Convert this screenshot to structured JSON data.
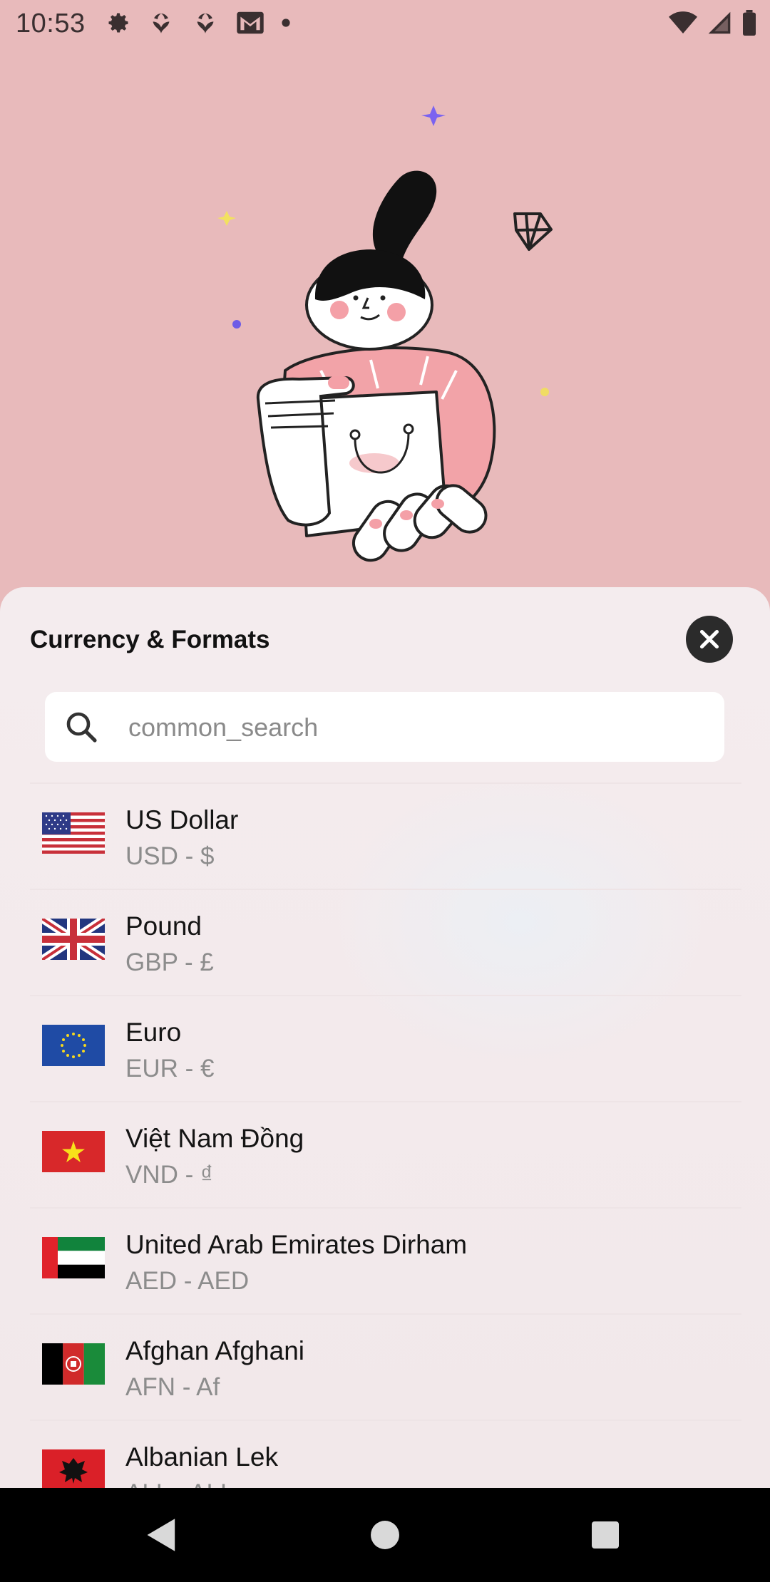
{
  "status_bar": {
    "time": "10:53",
    "left_icons": [
      "settings-icon",
      "app-icon",
      "app-icon",
      "gmail-icon",
      "dot-icon"
    ],
    "right_icons": [
      "wifi-icon",
      "signal-icon",
      "battery-icon"
    ]
  },
  "sheet": {
    "title": "Currency & Formats",
    "close_icon": "close-icon",
    "search": {
      "placeholder": "common_search",
      "value": "",
      "icon": "search-icon"
    }
  },
  "currencies": [
    {
      "name": "US Dollar",
      "code": "USD - $",
      "flag": "us-flag-icon"
    },
    {
      "name": "Pound",
      "code": "GBP - £",
      "flag": "uk-flag-icon"
    },
    {
      "name": "Euro",
      "code": "EUR - €",
      "flag": "eu-flag-icon"
    },
    {
      "name": "Việt Nam Đồng",
      "code": "VND - ₫",
      "flag": "vn-flag-icon"
    },
    {
      "name": "United Arab Emirates Dirham",
      "code": "AED - AED",
      "flag": "ae-flag-icon"
    },
    {
      "name": "Afghan Afghani",
      "code": "AFN - Af",
      "flag": "af-flag-icon"
    },
    {
      "name": "Albanian Lek",
      "code": "ALL - ALL",
      "flag": "al-flag-icon"
    }
  ],
  "nav_bar": {
    "back": "back-icon",
    "home": "home-icon",
    "recents": "recents-icon"
  },
  "colors": {
    "background": "#E8BABB",
    "sheet": "#F4ECEE",
    "close_button": "#2B2B2B",
    "title": "#121212",
    "subtitle": "#8C8C8C"
  }
}
